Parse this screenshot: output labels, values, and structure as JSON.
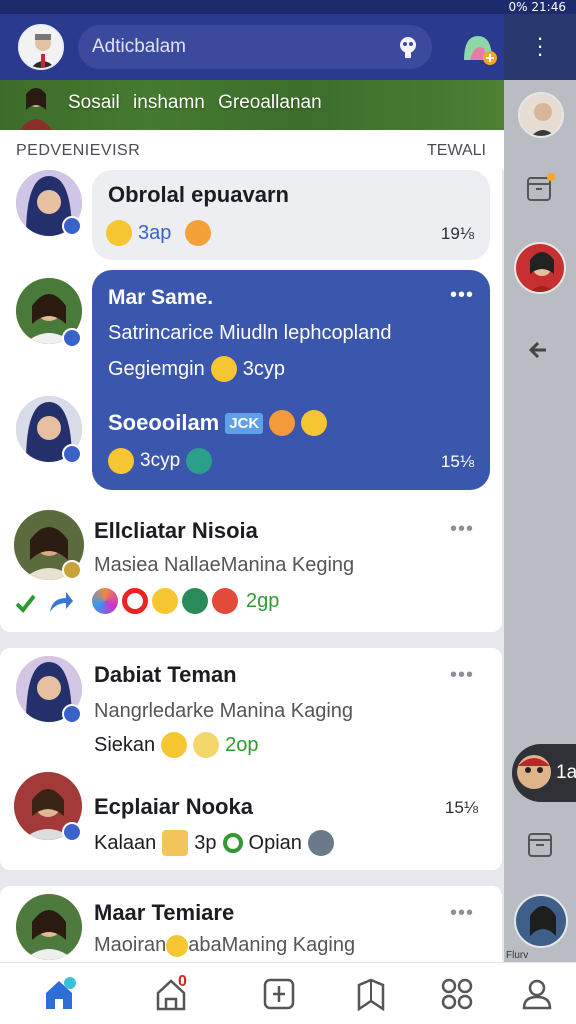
{
  "status": {
    "time": "21:46",
    "battery": "0%"
  },
  "search": {
    "text": "Adticbalam"
  },
  "banner": {
    "text": "Sosail inshamn Greoallanan"
  },
  "section": {
    "left": "PEDVENIEVISR",
    "right": "TEWALI"
  },
  "conversations": [
    {
      "name": "Obrolal epuavarn",
      "emoji_text": "3ap",
      "time": "19⅛"
    },
    {
      "name": "Mar Same.",
      "message": "Satrincarice Miudln lephcopland",
      "message2": "Gegiemgin",
      "message2_suffix": "3cyp",
      "sub_name": "Soeooilam",
      "sub_tag": "JCK",
      "reply_text": "3cyp",
      "time": "15⅛"
    },
    {
      "name": "Ellcliatar Nisoia",
      "message": "Masiea NallaeManina Keging",
      "reaction_text": "2gp"
    },
    {
      "name": "Dabiat Teman",
      "message": "Nangrledarke Manina Kaging",
      "message2": "Siekan",
      "reaction_text": "2op"
    },
    {
      "name": "Ecplaiar Nooka",
      "time": "15⅛",
      "message": "Kalaan",
      "meta1": "3p",
      "meta2": "Opian"
    },
    {
      "name": "Maar Temiare",
      "message": "Maoiran",
      "message_tail": "abaManing Kaging"
    }
  ],
  "rightcol": {
    "chat_badge": "1a",
    "label": "Flurv"
  },
  "nav": {
    "notif_count": "0"
  },
  "colors": {
    "primary": "#2a3a8f",
    "bubble": "#3a56ad",
    "accent_green": "#2f9a2f"
  }
}
